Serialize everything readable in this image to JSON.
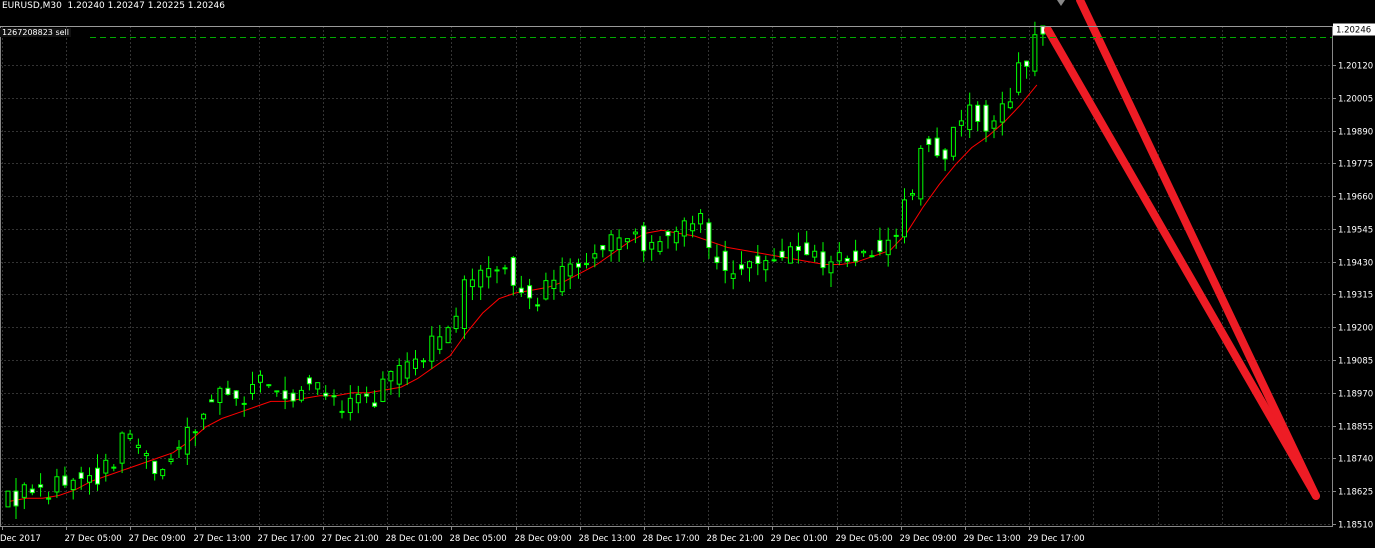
{
  "header": {
    "symbol_info": "EURUSD,M30  1.20240 1.20247 1.20225 1.20246"
  },
  "order_label": "1267208823 sell",
  "current_price_label": "1.20246",
  "colors": {
    "background": "#000000",
    "grid": "#333333",
    "bull_candle": "#00ff00",
    "moving_average": "#ff0000",
    "drawn_arrow": "#ee1c25",
    "order_line": "#00aa00"
  },
  "chart_data": {
    "type": "candlestick",
    "symbol": "EURUSD",
    "timeframe": "M30",
    "y_ticks": [
      "1.20120",
      "1.20005",
      "1.19890",
      "1.19775",
      "1.19660",
      "1.19545",
      "1.19430",
      "1.19315",
      "1.19200",
      "1.19085",
      "1.18970",
      "1.18855",
      "1.18740",
      "1.18625",
      "1.18510"
    ],
    "ylim": [
      1.1847,
      1.2052
    ],
    "x_ticks": [
      "Dec 2017",
      "27 Dec 05:00",
      "27 Dec 09:00",
      "27 Dec 13:00",
      "27 Dec 17:00",
      "27 Dec 21:00",
      "28 Dec 01:00",
      "28 Dec 05:00",
      "28 Dec 09:00",
      "28 Dec 13:00",
      "28 Dec 17:00",
      "28 Dec 21:00",
      "29 Dec 01:00",
      "29 Dec 05:00",
      "29 Dec 09:00",
      "29 Dec 13:00",
      "29 Dec 17:00"
    ],
    "last_price": 1.20246,
    "close_path": [
      1.186,
      1.1864,
      1.1862,
      1.1865,
      1.1866,
      1.1868,
      1.1872,
      1.188,
      1.1876,
      1.187,
      1.1876,
      1.1885,
      1.1892,
      1.1898,
      1.1895,
      1.1902,
      1.19,
      1.1895,
      1.19,
      1.1898,
      1.1893,
      1.1896,
      1.1895,
      1.1902,
      1.1905,
      1.191,
      1.1915,
      1.1922,
      1.1935,
      1.1938,
      1.1943,
      1.1932,
      1.193,
      1.1935,
      1.194,
      1.1943,
      1.1946,
      1.195,
      1.1953,
      1.1948,
      1.1952,
      1.1955,
      1.1958,
      1.1945,
      1.194,
      1.1943,
      1.1942,
      1.1945,
      1.1947,
      1.1944,
      1.1942,
      1.1944,
      1.1946,
      1.1948,
      1.1952,
      1.1965,
      1.1985,
      1.198,
      1.199,
      1.1995,
      1.199,
      1.2,
      1.2012,
      1.2025
    ],
    "moving_average": [
      1.1859,
      1.186,
      1.186,
      1.1861,
      1.1863,
      1.1866,
      1.1868,
      1.187,
      1.1872,
      1.1874,
      1.1876,
      1.188,
      1.1885,
      1.1888,
      1.189,
      1.1892,
      1.1894,
      1.1894,
      1.1895,
      1.1896,
      1.1896,
      1.1897,
      1.1897,
      1.1898,
      1.1899,
      1.1902,
      1.1906,
      1.191,
      1.1918,
      1.1925,
      1.193,
      1.1932,
      1.1933,
      1.1934,
      1.1936,
      1.1939,
      1.1942,
      1.1946,
      1.195,
      1.1953,
      1.1954,
      1.1953,
      1.1952,
      1.195,
      1.1948,
      1.1947,
      1.1946,
      1.1945,
      1.1944,
      1.1943,
      1.1942,
      1.1942,
      1.1943,
      1.1945,
      1.1947,
      1.1953,
      1.1962,
      1.197,
      1.1977,
      1.1983,
      1.1987,
      1.1992,
      1.1998,
      1.2005
    ],
    "grid": true
  }
}
